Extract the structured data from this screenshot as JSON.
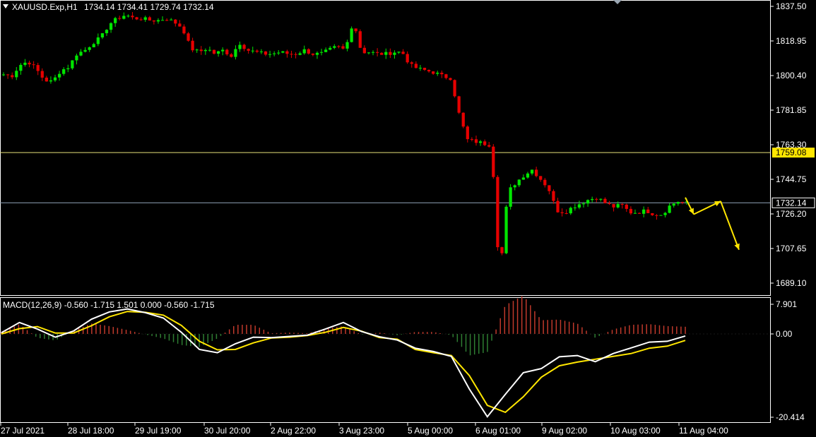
{
  "header": {
    "symbol_label": "XAUUSD.Exp,H1",
    "ohlc_label": "1734.14 1734.41 1729.74 1732.14"
  },
  "macd": {
    "label": "MACD(12,26,9) -0.560 -1.715 1.501 0.000 -0.560 -1.715"
  },
  "colors": {
    "background": "#000000",
    "bull_candle": "#00e600",
    "bear_candle": "#e60000",
    "axis_text": "#ffffff",
    "hline_level": "#e6e07a",
    "hline_current": "#8fa3b8",
    "arrow": "#ffe600",
    "macd_line": "#ffffff",
    "signal_line": "#ffe600",
    "hist_positive": "#c0392b",
    "hist_negative": "#2e7d32"
  },
  "chart_data": [
    {
      "type": "candlestick",
      "title": "XAUUSD.Exp,H1",
      "y_axis": {
        "ticks": [
          1837.5,
          1818.95,
          1800.4,
          1781.85,
          1763.3,
          1744.75,
          1726.2,
          1707.65,
          1689.1
        ],
        "range": [
          1685,
          1840
        ]
      },
      "x_axis": {
        "ticks": [
          "27 Jul 2021",
          "28 Jul 18:00",
          "29 Jul 19:00",
          "30 Jul 20:00",
          "2 Aug 22:00",
          "3 Aug 23:00",
          "5 Aug 00:00",
          "6 Aug 01:00",
          "9 Aug 02:00",
          "10 Aug 03:00",
          "11 Aug 04:00"
        ]
      },
      "horizontal_lines": [
        {
          "value": 1759.08,
          "label": "1759.08",
          "style": "level"
        },
        {
          "value": 1732.14,
          "label": "1732.14",
          "style": "current"
        }
      ],
      "close_path": [
        1801,
        1800,
        1806,
        1808,
        1804,
        1798,
        1797,
        1803,
        1805,
        1812,
        1814,
        1818,
        1821,
        1828,
        1831,
        1833,
        1831,
        1831,
        1830,
        1830,
        1831,
        1829,
        1826,
        1815,
        1813,
        1815,
        1812,
        1814,
        1811,
        1818,
        1814,
        1813,
        1812,
        1812,
        1813,
        1812,
        1812,
        1814,
        1812,
        1812,
        1814,
        1816,
        1814,
        1830,
        1813,
        1813,
        1812,
        1812,
        1813,
        1813,
        1806,
        1804,
        1803,
        1802,
        1800,
        1799,
        1780,
        1766,
        1765,
        1764,
        1763,
        1692,
        1738,
        1743,
        1747,
        1750,
        1745,
        1740,
        1728,
        1727,
        1730,
        1732,
        1734,
        1735,
        1732,
        1730,
        1731,
        1727,
        1727,
        1728,
        1726,
        1726,
        1731,
        1733,
        1732
      ],
      "projection_path": [
        1735,
        1726,
        1733,
        1707
      ]
    },
    {
      "type": "line",
      "title": "MACD(12,26,9)",
      "y_axis": {
        "ticks": [
          7.901,
          0.0,
          -20.414
        ],
        "range": [
          -21,
          8
        ]
      },
      "series": [
        {
          "name": "MACD",
          "values": [
            0.3,
            2.8,
            1.2,
            -0.8,
            0.7,
            3.6,
            5.4,
            6.1,
            5.2,
            3.9,
            0.4,
            -3.8,
            -4.6,
            -2.4,
            -0.8,
            -0.9,
            -0.6,
            -0.3,
            1.2,
            2.8,
            0.6,
            -0.7,
            -1.5,
            -3.5,
            -4.3,
            -5.5,
            -13.5,
            -20.3,
            -14.8,
            -9.5,
            -8.5,
            -5.6,
            -5.3,
            -6.8,
            -4.8,
            -3.4,
            -2.0,
            -1.8,
            -0.5
          ]
        },
        {
          "name": "Signal",
          "values": [
            0.0,
            1.3,
            1.8,
            0.2,
            0.2,
            2.0,
            4.2,
            5.5,
            5.3,
            4.6,
            2.1,
            -1.8,
            -3.9,
            -3.8,
            -2.2,
            -1.0,
            -0.8,
            -0.4,
            0.4,
            1.6,
            0.7,
            -0.9,
            -1.3,
            -3.8,
            -4.6,
            -5.3,
            -10.2,
            -17.5,
            -19.2,
            -15.4,
            -10.6,
            -7.8,
            -6.9,
            -6.2,
            -5.5,
            -4.8,
            -3.5,
            -3.0,
            -1.6
          ]
        },
        {
          "name": "Histogram",
          "values": [
            0.3,
            1.5,
            -0.6,
            -1.0,
            0.5,
            1.6,
            1.2,
            0.6,
            -0.1,
            -0.7,
            -1.7,
            -2.0,
            -0.7,
            1.4,
            1.4,
            0.1,
            0.2,
            0.1,
            0.8,
            1.2,
            -0.1,
            0.2,
            -0.2,
            0.3,
            0.3,
            -0.2,
            -3.3,
            -2.8,
            4.4,
            5.9,
            2.1,
            2.2,
            1.6,
            -0.6,
            0.7,
            1.4,
            1.5,
            1.2,
            1.1
          ]
        }
      ]
    }
  ]
}
